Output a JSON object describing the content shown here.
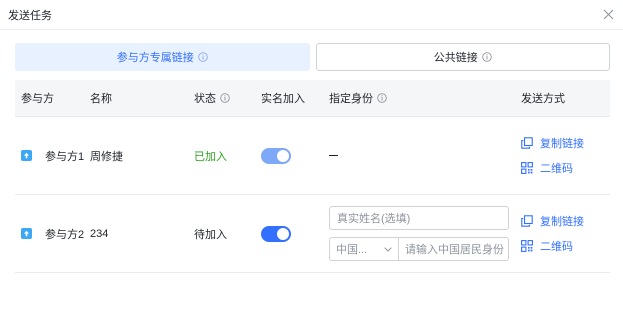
{
  "dialog": {
    "title": "发送任务"
  },
  "tabs": [
    {
      "label": "参与方专属链接",
      "active": true
    },
    {
      "label": "公共链接",
      "active": false
    }
  ],
  "table": {
    "headers": {
      "party": "参与方",
      "name": "名称",
      "status": "状态",
      "real_name": "实名加入",
      "identity": "指定身份",
      "send_method": "发送方式"
    },
    "rows": [
      {
        "party": "参与方1",
        "name": "周修捷",
        "status": "已加入",
        "real_name_on": true,
        "identity": "—",
        "copy_link": "复制链接",
        "qrcode": "二维码"
      },
      {
        "party": "参与方2",
        "name": "234",
        "status": "待加入",
        "real_name_on": true,
        "identity_name_placeholder": "真实姓名(选填)",
        "id_type": "中国...",
        "id_number_placeholder": "请输入中国居民身份",
        "copy_link": "复制链接",
        "qrcode": "二维码"
      }
    ]
  },
  "colors": {
    "accent": "#3370ff",
    "joined": "#2ea121",
    "header_bg": "#f5f6f7"
  }
}
